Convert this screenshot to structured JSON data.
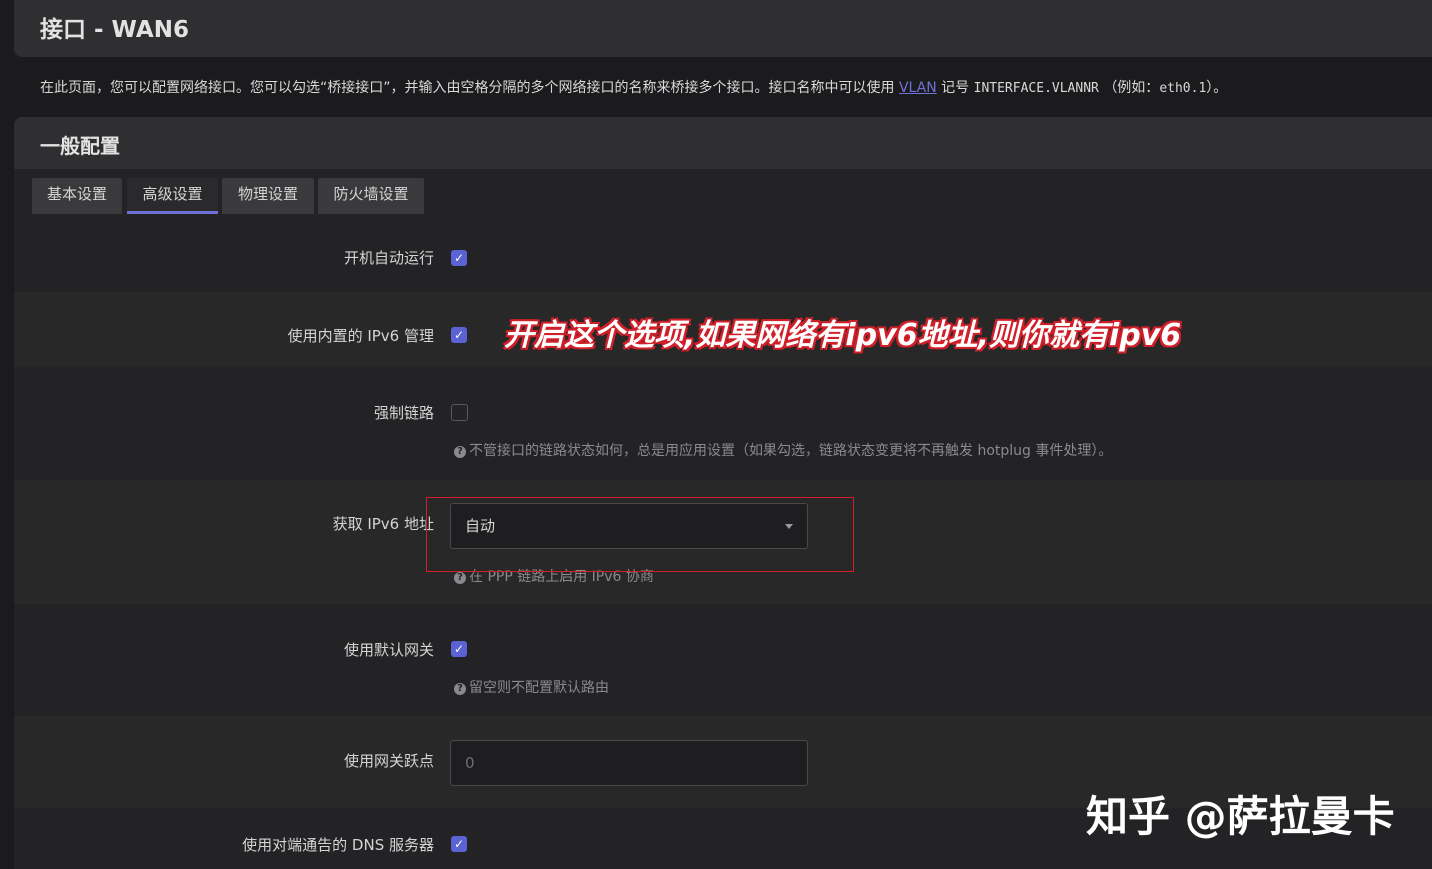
{
  "page": {
    "title": "接口 - WAN6"
  },
  "description": {
    "prefix": "在此页面，您可以配置网络接口。您可以勾选“桥接接口”，并输入由空格分隔的多个网络接口的名称来桥接多个接口。接口名称中可以使用",
    "link": "VLAN",
    "middle": "记号",
    "code": "INTERFACE.VLANNR",
    "example_prefix": "（例如：",
    "example_code": "eth0.1",
    "suffix": "）。"
  },
  "section": {
    "title": "一般配置"
  },
  "tabs": [
    {
      "label": "基本设置",
      "active": false
    },
    {
      "label": "高级设置",
      "active": true
    },
    {
      "label": "物理设置",
      "active": false
    },
    {
      "label": "防火墙设置",
      "active": false
    }
  ],
  "fields": {
    "auto_start": {
      "label": "开机自动运行",
      "checked": true
    },
    "builtin_ipv6": {
      "label": "使用内置的 IPv6 管理",
      "checked": true
    },
    "force_link": {
      "label": "强制链路",
      "checked": false,
      "help": "不管接口的链路状态如何，总是用应用设置（如果勾选，链路状态变更将不再触发 hotplug 事件处理）。"
    },
    "obtain_ipv6": {
      "label": "获取 IPv6 地址",
      "value": "自动",
      "help": "在 PPP 链路上启用 IPv6 协商"
    },
    "default_gateway": {
      "label": "使用默认网关",
      "checked": true,
      "help": "留空则不配置默认路由"
    },
    "gateway_metric": {
      "label": "使用网关跃点",
      "placeholder": "0"
    },
    "peer_dns": {
      "label": "使用对端通告的 DNS 服务器",
      "checked": true
    }
  },
  "annotation": {
    "text": "开启这个选项,如果网络有ipv6地址,则你就有ipv6",
    "color": "#d0202a"
  },
  "watermark": {
    "text": "知乎 @萨拉曼卡"
  },
  "colors": {
    "accent": "#5b62d4",
    "background": "#1b1b1d",
    "highlight_box": "#d0202a"
  }
}
